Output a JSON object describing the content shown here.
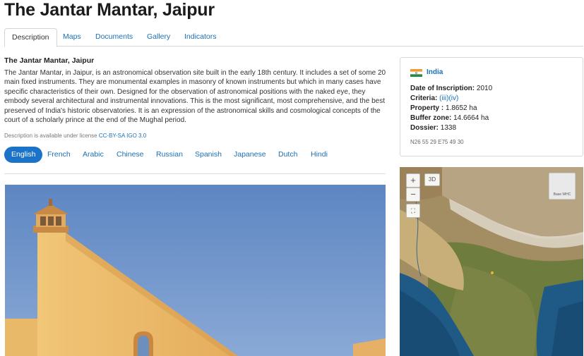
{
  "page": {
    "title": "The Jantar Mantar, Jaipur"
  },
  "tabs": [
    {
      "label": "Description",
      "active": true
    },
    {
      "label": "Maps",
      "active": false
    },
    {
      "label": "Documents",
      "active": false
    },
    {
      "label": "Gallery",
      "active": false
    },
    {
      "label": "Indicators",
      "active": false
    }
  ],
  "description": {
    "heading": "The Jantar Mantar, Jaipur",
    "body": "The Jantar Mantar, in Jaipur, is an astronomical observation site built in the early 18th century. It includes a set of some 20 main fixed instruments. They are monumental examples in masonry of known instruments but which in many cases have specific characteristics of their own. Designed for the observation of astronomical positions with the naked eye, they embody several architectural and instrumental innovations. This is the most significant, most comprehensive, and the best preserved of India's historic observatories. It is an expression of the astronomical skills and cosmological concepts of the court of a scholarly prince at the end of the Mughal period.",
    "license_prefix": "Description is available under license",
    "license_link": "CC-BY-SA IGO 3.0"
  },
  "languages": [
    {
      "label": "English",
      "active": true
    },
    {
      "label": "French",
      "active": false
    },
    {
      "label": "Arabic",
      "active": false
    },
    {
      "label": "Chinese",
      "active": false
    },
    {
      "label": "Russian",
      "active": false
    },
    {
      "label": "Spanish",
      "active": false
    },
    {
      "label": "Japanese",
      "active": false
    },
    {
      "label": "Dutch",
      "active": false
    },
    {
      "label": "Hindi",
      "active": false
    }
  ],
  "info": {
    "country": "India",
    "date_label": "Date of Inscription:",
    "date_value": "2010",
    "criteria_label": "Criteria:",
    "criteria_value": "(iii)(iv)",
    "property_label": "Property :",
    "property_value": "1.8652 ha",
    "buffer_label": "Buffer zone:",
    "buffer_value": "14.6664 ha",
    "dossier_label": "Dossier:",
    "dossier_value": "1338",
    "coords": "N26 55 29 E75 49 30"
  },
  "map": {
    "zoom_in": "+",
    "zoom_out": "−",
    "mode_3d": "3D",
    "basemap_label": "Base WHC"
  },
  "colors": {
    "accent": "#1a73c8",
    "link": "#1a6fb5",
    "sky": "#6f93c7",
    "monument": "#e8b765"
  },
  "icons": {
    "fullscreen": "fullscreen-icon",
    "flag": "india-flag-icon"
  }
}
